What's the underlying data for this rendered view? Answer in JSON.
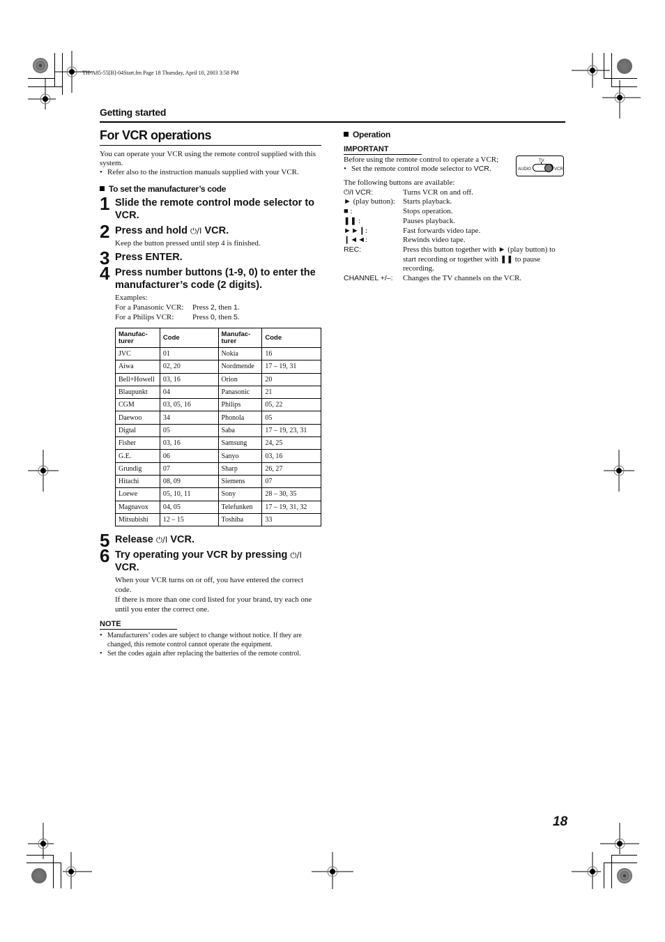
{
  "file_info": "TH-A85-55[B]-04Start.fm  Page 18  Thursday, April 10, 2003  3:58 PM",
  "section_label": "Getting started",
  "page_number": "18",
  "left": {
    "title": "For VCR operations",
    "intro": "You can operate your VCR using the remote control supplied with this system.",
    "intro_bullet": "Refer also to the instruction manuals supplied with your VCR.",
    "subhead": "To set the manufacturer’s code",
    "steps": [
      {
        "num": "1",
        "text": "Slide the remote control mode selector to VCR."
      },
      {
        "num": "2",
        "text_pre": "Press and hold ",
        "text_post": " VCR.",
        "desc": "Keep the button pressed until step 4 is finished."
      },
      {
        "num": "3",
        "text": "Press ENTER."
      },
      {
        "num": "4",
        "text": "Press number buttons (1-9, 0) to enter the manufacturer’s code (2 digits).",
        "examples_label": "Examples:",
        "examples": [
          {
            "label": "For a Panasonic VCR:",
            "pre": "Press ",
            "a": "2",
            "mid": ", then ",
            "b": "1",
            "post": "."
          },
          {
            "label": "For a Philips VCR:",
            "pre": "Press ",
            "a": "0",
            "mid": ", then ",
            "b": "5",
            "post": "."
          }
        ]
      },
      {
        "num": "5",
        "text_pre": "Release ",
        "text_post": " VCR."
      },
      {
        "num": "6",
        "text_pre": "Try operating your VCR by pressing ",
        "text_post": " VCR.",
        "desc1": "When your VCR turns on or off, you have entered the correct code.",
        "desc2": "If there is more than one cord listed for your brand, try each one until you enter the correct one."
      }
    ],
    "power_glyph": "⏻/I",
    "table": {
      "headers": [
        "Manufac-\nturer",
        "Code",
        "Manufac-\nturer",
        "Code"
      ],
      "header_line1": "Manufac-",
      "header_line2": "turer",
      "code_header": "Code",
      "rows": [
        [
          "JVC",
          "01",
          "Nokia",
          "16"
        ],
        [
          "Aiwa",
          "02, 20",
          "Nordmende",
          "17 – 19, 31"
        ],
        [
          "Bell+Howell",
          "03, 16",
          "Orion",
          "20"
        ],
        [
          "Blaupunkt",
          "04",
          "Panasonic",
          "21"
        ],
        [
          "CGM",
          "03, 05, 16",
          "Philips",
          "05, 22"
        ],
        [
          "Daewoo",
          "34",
          "Phonola",
          "05"
        ],
        [
          "Digtal",
          "05",
          "Saba",
          "17 – 19, 23, 31"
        ],
        [
          "Fisher",
          "03, 16",
          "Samsung",
          "24, 25"
        ],
        [
          "G.E.",
          "06",
          "Sanyo",
          "03, 16"
        ],
        [
          "Grundig",
          "07",
          "Sharp",
          "26, 27"
        ],
        [
          "Hitachi",
          "08, 09",
          "Siemens",
          "07"
        ],
        [
          "Loewe",
          "05, 10, 11",
          "Sony",
          "28 – 30, 35"
        ],
        [
          "Magnavox",
          "04, 05",
          "Telefunken",
          "17 – 19, 31, 32"
        ],
        [
          "Mitsubishi",
          "12 – 15",
          "Toshiba",
          "33"
        ]
      ]
    },
    "note": {
      "heading": "NOTE",
      "items": [
        "Manufacturers’ codes are subject to change without notice. If they are changed, this remote control cannot operate the equipment.",
        "Set the codes again after replacing the batteries of the remote control."
      ]
    }
  },
  "right": {
    "subhead": "Operation",
    "important": {
      "heading": "IMPORTANT",
      "text": "Before using the remote control to operate a VCR;",
      "bullet_pre": "Set the remote control mode selector to ",
      "bullet_key": "VCR",
      "bullet_post": "."
    },
    "selector": {
      "tv": "TV",
      "audio": "AUDIO",
      "vcr": "VCR",
      "selected": "VCR"
    },
    "buttons_intro": "The following buttons are available:",
    "buttons": [
      {
        "key": "⏻/I VCR:",
        "icon": "power-icon",
        "desc": "Turns VCR on and off."
      },
      {
        "key": "► (play button):",
        "icon": "play-icon",
        "desc": "Starts playback."
      },
      {
        "key": "■ :",
        "icon": "stop-icon",
        "desc": "Stops operation."
      },
      {
        "key": "❚❚ :",
        "icon": "pause-icon",
        "desc": "Pauses playback."
      },
      {
        "key": "►►❙:",
        "icon": "fast-forward-icon",
        "desc": "Fast forwards video tape."
      },
      {
        "key": "❙◄◄:",
        "icon": "rewind-icon",
        "desc": "Rewinds video tape."
      },
      {
        "key": "REC:",
        "icon": "",
        "desc": "Press this button together with ► (play button) to start recording or together with ❚❚ to pause recording."
      },
      {
        "key": "CHANNEL +/–:",
        "icon": "",
        "desc": "Changes the TV channels on the VCR."
      }
    ]
  }
}
